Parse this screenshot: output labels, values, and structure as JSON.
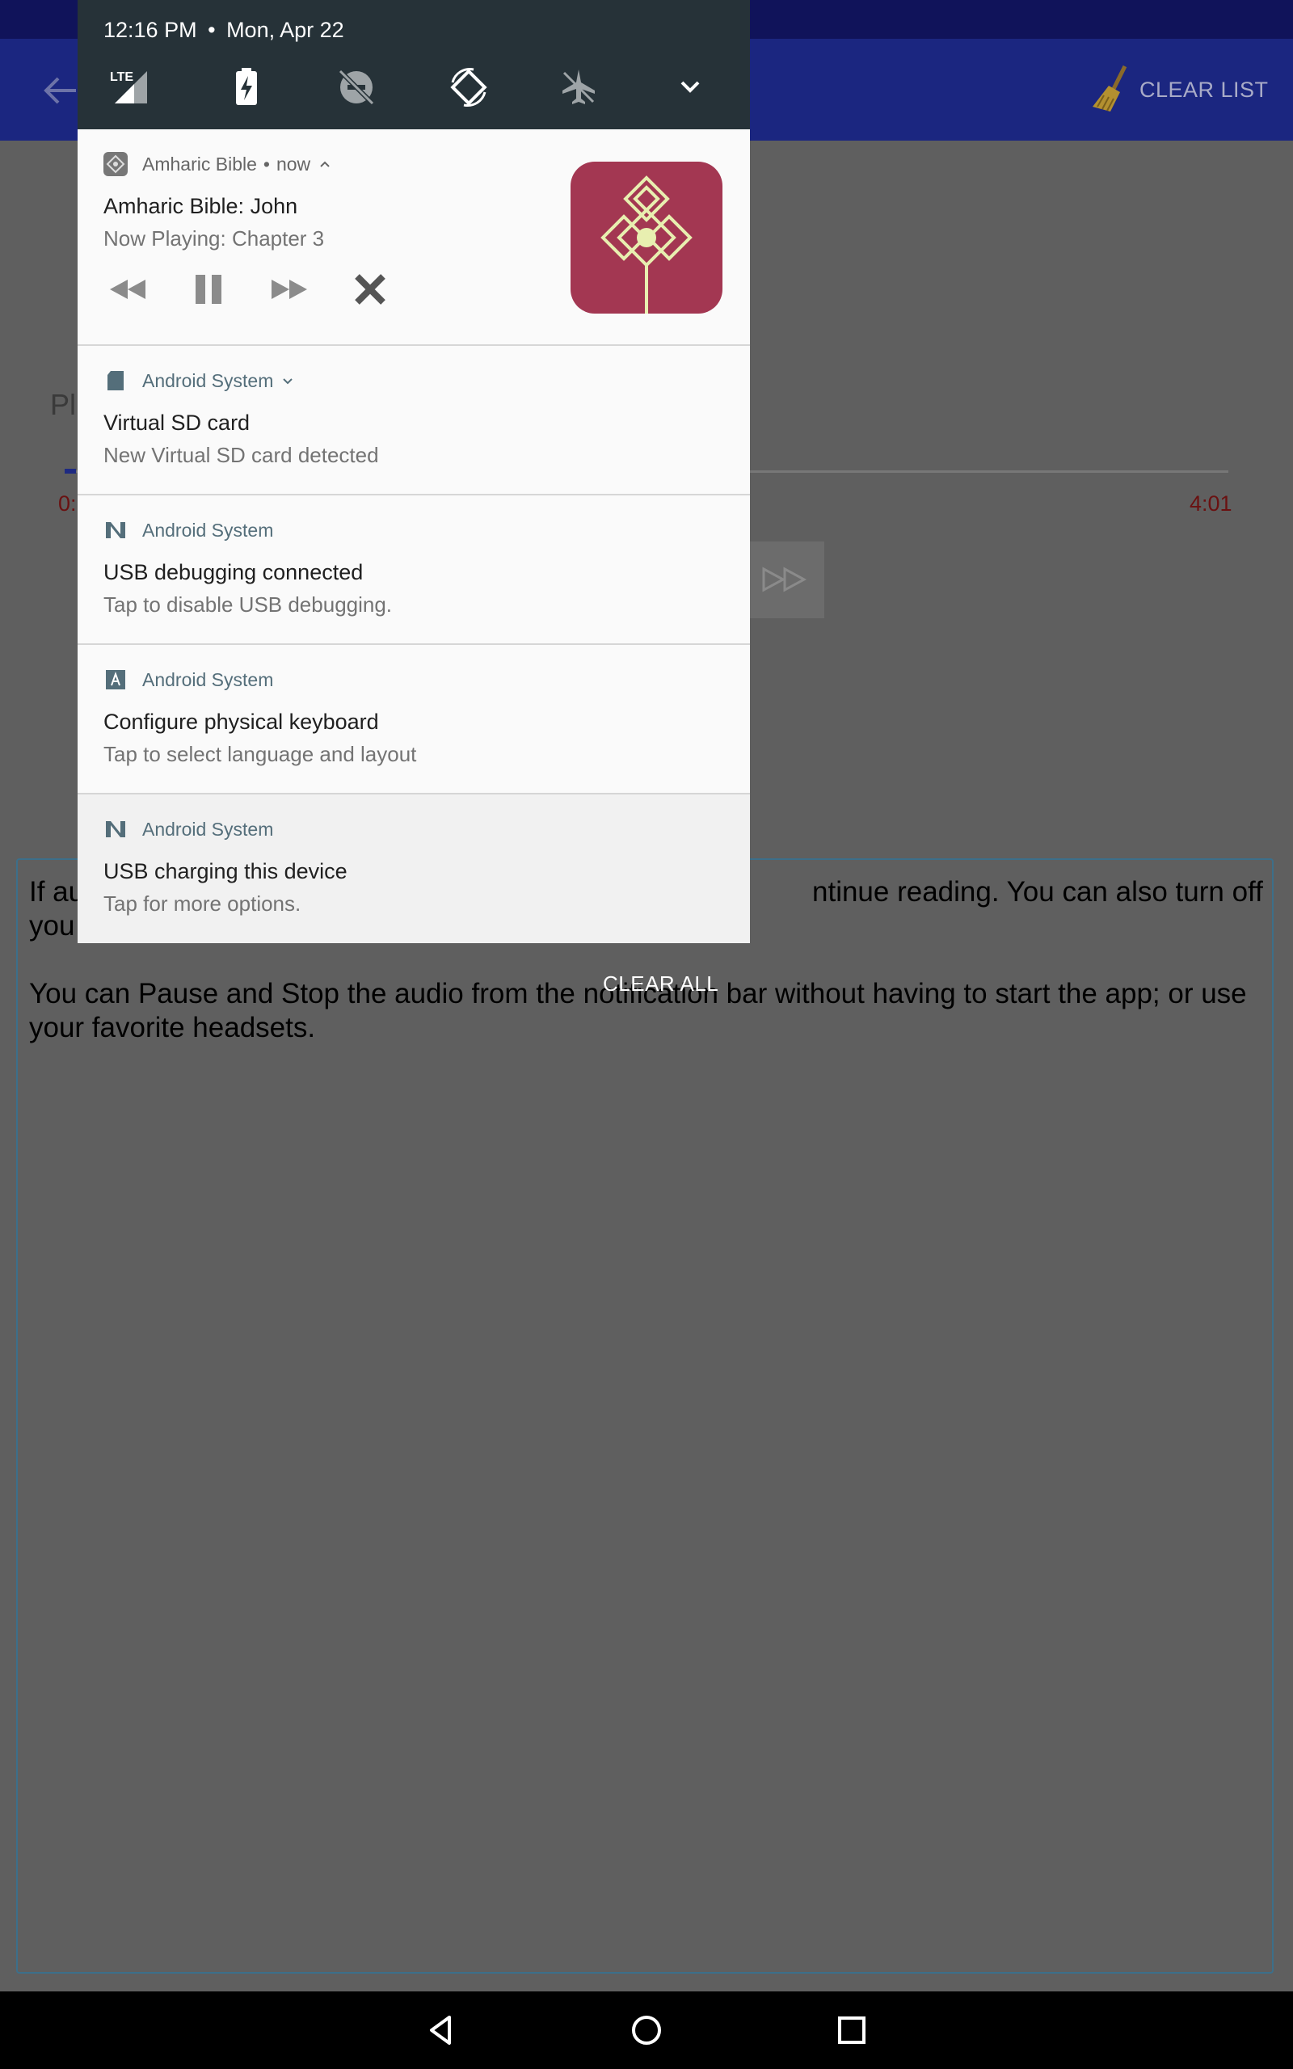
{
  "app": {
    "clear_list_label": "CLEAR LIST",
    "player_label_fragment": "Pl",
    "time_start_fragment": "0:",
    "time_end": "4:01",
    "info_line1_start": "If au",
    "info_line1_end": "ntinue reading. You can also turn off",
    "info_line2_start": "you",
    "info_para2": "You can Pause and Stop the audio from the notification bar without having to start the app; or use your favorite headsets."
  },
  "shade": {
    "time": "12:16 PM",
    "separator": "•",
    "date": "Mon, Apr 22",
    "quick_settings": [
      "lte-signal-icon",
      "battery-charging-icon",
      "do-not-disturb-off-icon",
      "auto-rotate-icon",
      "airplane-mode-icon",
      "expand-chevron-icon"
    ],
    "clear_all_label": "CLEAR ALL"
  },
  "notifications": {
    "media": {
      "app_name": "Amharic Bible",
      "time": "now",
      "title": "Amharic Bible: John",
      "subtitle": "Now Playing: Chapter 3",
      "controls": [
        "rewind-icon",
        "pause-icon",
        "fast-forward-icon",
        "close-icon"
      ],
      "art_color": "#a33752"
    },
    "sd_card": {
      "app_name": "Android System",
      "title": "Virtual SD card",
      "subtitle": "New Virtual SD card detected"
    },
    "usb_debugging": {
      "app_name": "Android System",
      "title": "USB debugging connected",
      "subtitle": "Tap to disable USB debugging."
    },
    "keyboard": {
      "app_name": "Android System",
      "title": "Configure physical keyboard",
      "subtitle": "Tap to select language and layout"
    },
    "usb_charging": {
      "app_name": "Android System",
      "title": "USB charging this device",
      "subtitle": "Tap for more options."
    }
  },
  "colors": {
    "app_bar": "#1b2680",
    "shade_header": "#263238",
    "app_name_accent": "#546e7a",
    "scrim": "#5f5f5f"
  }
}
